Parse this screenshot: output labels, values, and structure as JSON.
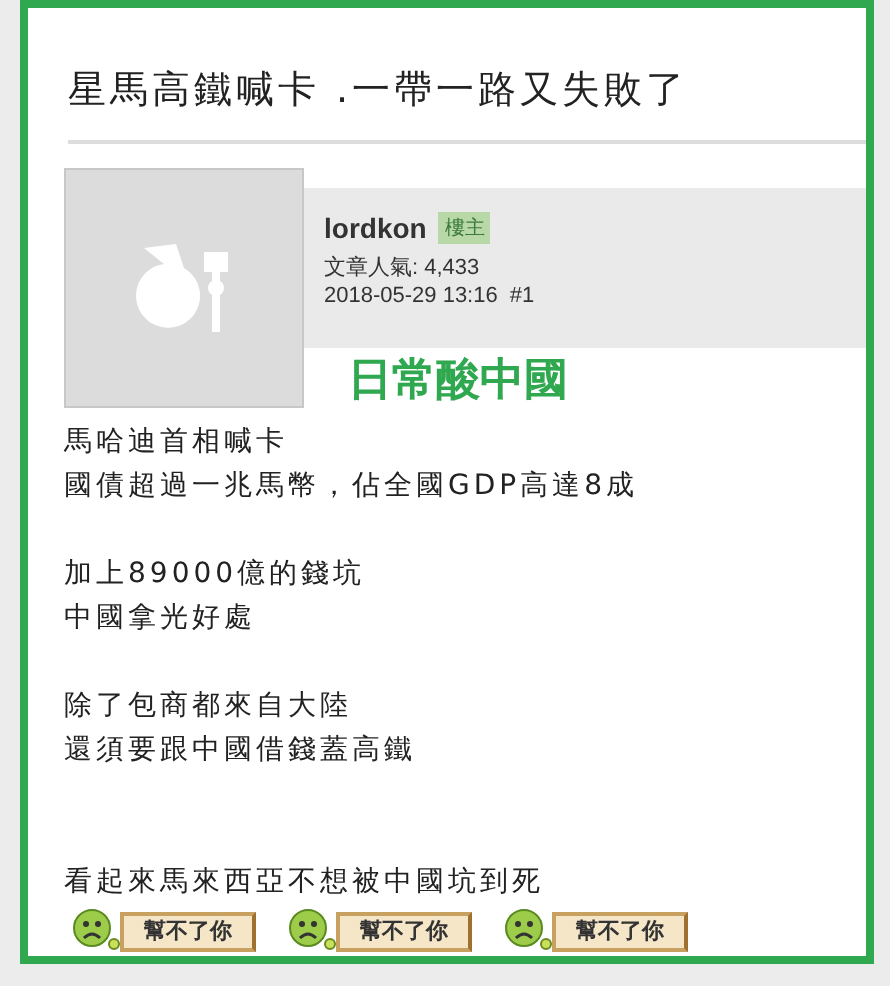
{
  "thread_title": "星馬高鐵喊卡 .一帶一路又失敗了",
  "post": {
    "author": "lordkon",
    "role_badge": "樓主",
    "popularity": "文章人氣: 4,433",
    "timestamp": "2018-05-29 13:16",
    "floor": "#1",
    "headline": "日常酸中國",
    "paragraphs": [
      [
        "馬哈迪首相喊卡",
        "國債超過一兆馬幣，佔全國GDP高達8成"
      ],
      [
        "加上89000億的錢坑",
        "中國拿光好處"
      ],
      [
        "除了包商都來自大陸",
        "還須要跟中國借錢蓋高鐵"
      ],
      [
        "看起來馬來西亞不想被中國坑到死"
      ]
    ],
    "stickers": [
      {
        "label": "幫不了你"
      },
      {
        "label": "幫不了你"
      },
      {
        "label": "幫不了你"
      }
    ]
  }
}
